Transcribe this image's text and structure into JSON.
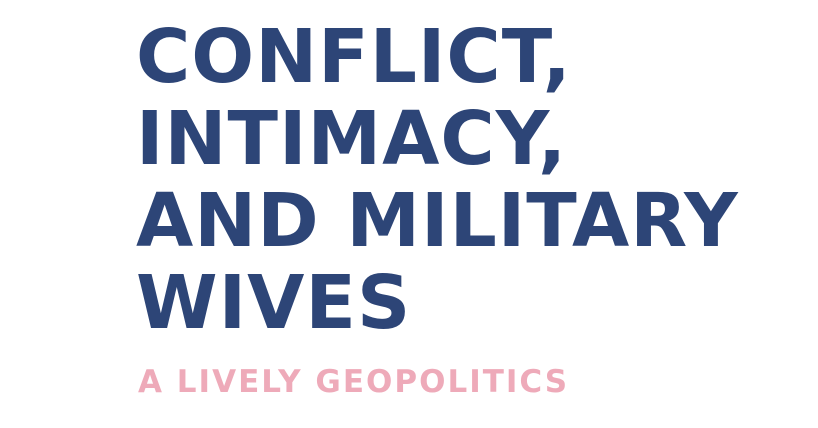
{
  "title_lines": [
    "CONFLICT,",
    "INTIMACY,",
    "AND MILITARY",
    "WIVES"
  ],
  "subtitle": "A LIVELY GEOPOLITICS",
  "colors": {
    "background": "#ffffff",
    "title": "#2d4577",
    "subtitle": "#eeaab9"
  }
}
